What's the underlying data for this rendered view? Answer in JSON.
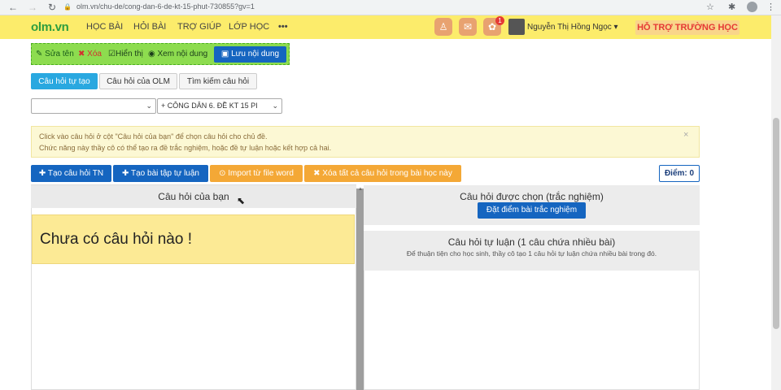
{
  "browser": {
    "url": "olm.vn/chu-de/cong-dan-6-de-kt-15-phut-730855?gv=1"
  },
  "header": {
    "logo": "olm.vn",
    "nav": [
      "HỌC BÀI",
      "HỎI BÀI",
      "TRỢ GIÚP",
      "LỚP HỌC",
      "•••"
    ],
    "notif_count": "1",
    "username": "Nguyễn Thị Hồng Ngọc ▾",
    "support": "HỖ TRỢ TRƯỜNG HỌC",
    "colors": {
      "bar": "#fcec6b",
      "logo": "#2e9e3f",
      "support": "#e53935"
    }
  },
  "toolbar": {
    "rename": "Sửa tên",
    "delete": "Xóa",
    "show": "Hiển thị",
    "view": "Xem nội dung",
    "save": "Lưu nội dung"
  },
  "tabs": [
    "Câu hỏi tự tạo",
    "Câu hỏi của OLM",
    "Tìm kiếm câu hỏi"
  ],
  "selects": {
    "first": "",
    "second": "+ CÔNG DÂN 6. ĐỀ KT 15 PI"
  },
  "alert": {
    "line1": "Click vào câu hỏi ở cột \"Câu hỏi của bạn\" để chọn câu hỏi cho chủ đề.",
    "line2": "Chức năng này thầy cô có thể tạo ra đề trắc nghiệm, hoặc đề tự luận hoặc kết hợp cả hai."
  },
  "actions": {
    "create_mc": "Tạo câu hỏi TN",
    "create_essay": "Tạo bài tập tự luận",
    "import_word": "Import từ file word",
    "delete_all": "Xóa tất cả câu hỏi trong bài học này",
    "score": "Điểm: 0"
  },
  "left_panel": {
    "title": "Câu hỏi của bạn",
    "empty": "Chưa có câu hỏi nào !"
  },
  "right_panel": {
    "mc_title": "Câu hỏi được chọn (trắc nghiệm)",
    "grade_button": "Đặt điểm bài trắc nghiệm",
    "essay_title": "Câu hỏi tự luận (1 câu chứa nhiều bài)",
    "essay_sub": "Để thuận tiện cho học sinh, thầy cô tạo 1 câu hỏi tự luận chứa nhiều bài trong đó."
  }
}
